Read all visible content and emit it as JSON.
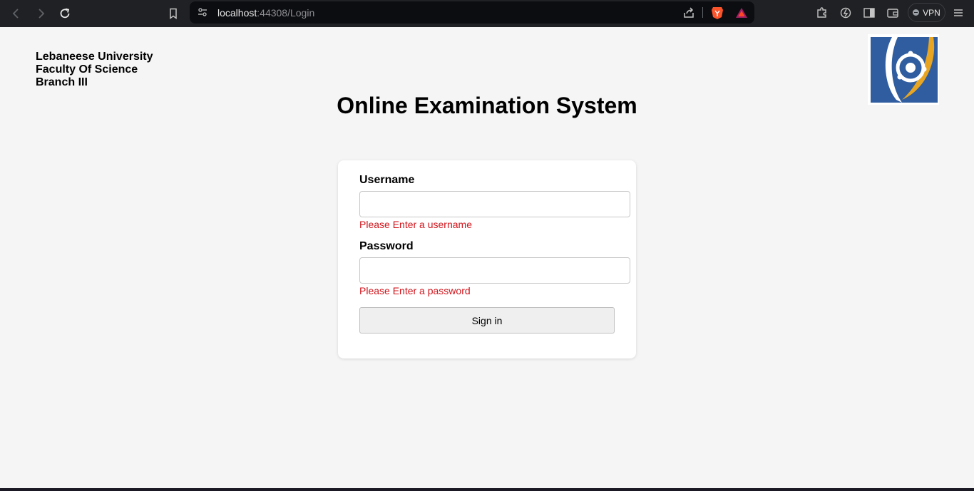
{
  "browser": {
    "url_host": "localhost",
    "url_path": ":44308/Login",
    "vpn_label": "VPN"
  },
  "header": {
    "institution_lines": [
      "Lebaneese University",
      "Faculty Of Science",
      "Branch III"
    ],
    "title": "Online Examination System"
  },
  "form": {
    "username_label": "Username",
    "username_value": "",
    "username_error": "Please Enter a username",
    "password_label": "Password",
    "password_value": "",
    "password_error": "Please Enter a password",
    "submit_label": "Sign in"
  },
  "colors": {
    "error": "#d0141b",
    "logo_blue": "#2f5d9f",
    "logo_gold": "#e8a521"
  }
}
